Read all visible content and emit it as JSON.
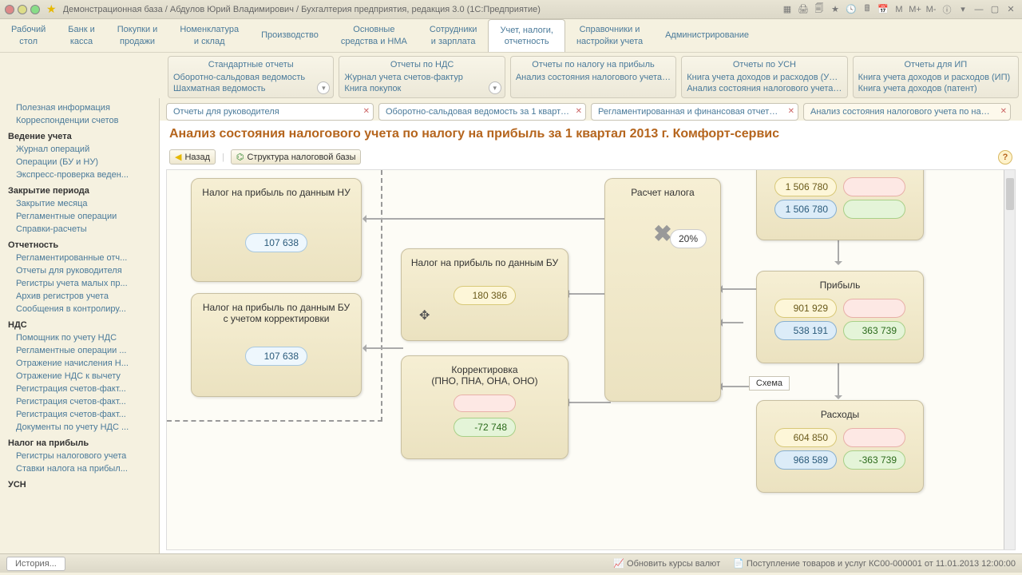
{
  "title": "Демонстрационная база / Абдулов Юрий Владимирович / Бухгалтерия предприятия, редакция 3.0  (1С:Предприятие)",
  "topnav": [
    "Рабочий\nстол",
    "Банк и\nкасса",
    "Покупки и\nпродажи",
    "Номенклатура\nи склад",
    "Производство",
    "Основные\nсредства и НМА",
    "Сотрудники\nи зарплата",
    "Учет, налоги,\nотчетность",
    "Справочники и\nнастройки учета",
    "Администрирование"
  ],
  "topnav_active": 7,
  "groups": [
    {
      "head": "Стандартные отчеты",
      "items": [
        "Оборотно-сальдовая ведомость",
        "Шахматная ведомость"
      ],
      "dd": true
    },
    {
      "head": "Отчеты по НДС",
      "items": [
        "Журнал учета счетов-фактур",
        "Книга покупок"
      ],
      "dd": true
    },
    {
      "head": "Отчеты по налогу на прибыль",
      "items": [
        "Анализ состояния налогового учета п..."
      ],
      "dd": false
    },
    {
      "head": "Отчеты по УСН",
      "items": [
        "Книга учета доходов и расходов (УСН)",
        "Анализ состояния налогового учета п..."
      ],
      "dd": false
    },
    {
      "head": "Отчеты для ИП",
      "items": [
        "Книга учета доходов и расходов (ИП)",
        "Книга учета доходов (патент)"
      ],
      "dd": false
    }
  ],
  "sidebar": [
    {
      "head": null,
      "items": [
        "Полезная информация",
        "Корреспонденции счетов"
      ]
    },
    {
      "head": "Ведение учета",
      "items": [
        "Журнал операций",
        "Операции (БУ и НУ)",
        "Экспресс-проверка веден..."
      ]
    },
    {
      "head": "Закрытие периода",
      "items": [
        "Закрытие месяца",
        "Регламентные операции",
        "Справки-расчеты"
      ]
    },
    {
      "head": "Отчетность",
      "items": [
        "Регламентированные отч...",
        "Отчеты для руководителя",
        "Регистры учета малых пр...",
        "Архив регистров учета",
        "Сообщения в контролиру..."
      ]
    },
    {
      "head": "НДС",
      "items": [
        "Помощник по учету НДС",
        "Регламентные операции ...",
        "Отражение начисления Н...",
        "Отражение НДС к вычету",
        "Регистрация счетов-факт...",
        "Регистрация счетов-факт...",
        "Регистрация счетов-факт...",
        "Документы по учету НДС ..."
      ]
    },
    {
      "head": "Налог на прибыль",
      "items": [
        "Регистры налогового учета",
        "Ставки налога на прибыл..."
      ]
    },
    {
      "head": "УСН",
      "items": []
    }
  ],
  "doctabs": [
    {
      "label": "Отчеты для руководителя"
    },
    {
      "label": "Оборотно-сальдовая ведомость за 1 кварта..."
    },
    {
      "label": "Регламентированная и финансовая отчетнос..."
    },
    {
      "label": "Анализ состояния налогового учета по нало...",
      "active": true
    }
  ],
  "page_title": "Анализ состояния налогового учета по налогу на прибыль за 1 квартал 2013 г. Комфорт-сервис",
  "toolbar": {
    "back": "Назад",
    "structure": "Структура налоговой базы"
  },
  "diagram": {
    "nu": {
      "title": "Налог на прибыль по данным НУ",
      "v": "107 638"
    },
    "bu_corr": {
      "title": "Налог на прибыль по данным БУ\nс учетом корректировки",
      "v": "107 638"
    },
    "bu": {
      "title": "Налог на прибыль по данным БУ",
      "v": "180 386"
    },
    "corr": {
      "title": "Корректировка\n(ПНО, ПНА, ОНА, ОНО)",
      "v_red": "",
      "v_green": "-72 748"
    },
    "calc": {
      "title": "Расчет налога",
      "pct": "20%"
    },
    "top": {
      "yellow": "1 506 780",
      "blue": "1 506 780"
    },
    "profit": {
      "title": "Прибыль",
      "yellow": "901 929",
      "blue": "538 191",
      "green": "363 739"
    },
    "expense": {
      "title": "Расходы",
      "yellow": "604 850",
      "blue": "968 589",
      "green": "-363 739"
    },
    "schema": "Схема"
  },
  "statusbar": {
    "history": "История...",
    "s1": "Обновить курсы валют",
    "s2": "Поступление товаров и услуг КС00-000001 от 11.01.2013 12:00:00"
  },
  "tb_right": [
    "M",
    "M+",
    "M-"
  ]
}
